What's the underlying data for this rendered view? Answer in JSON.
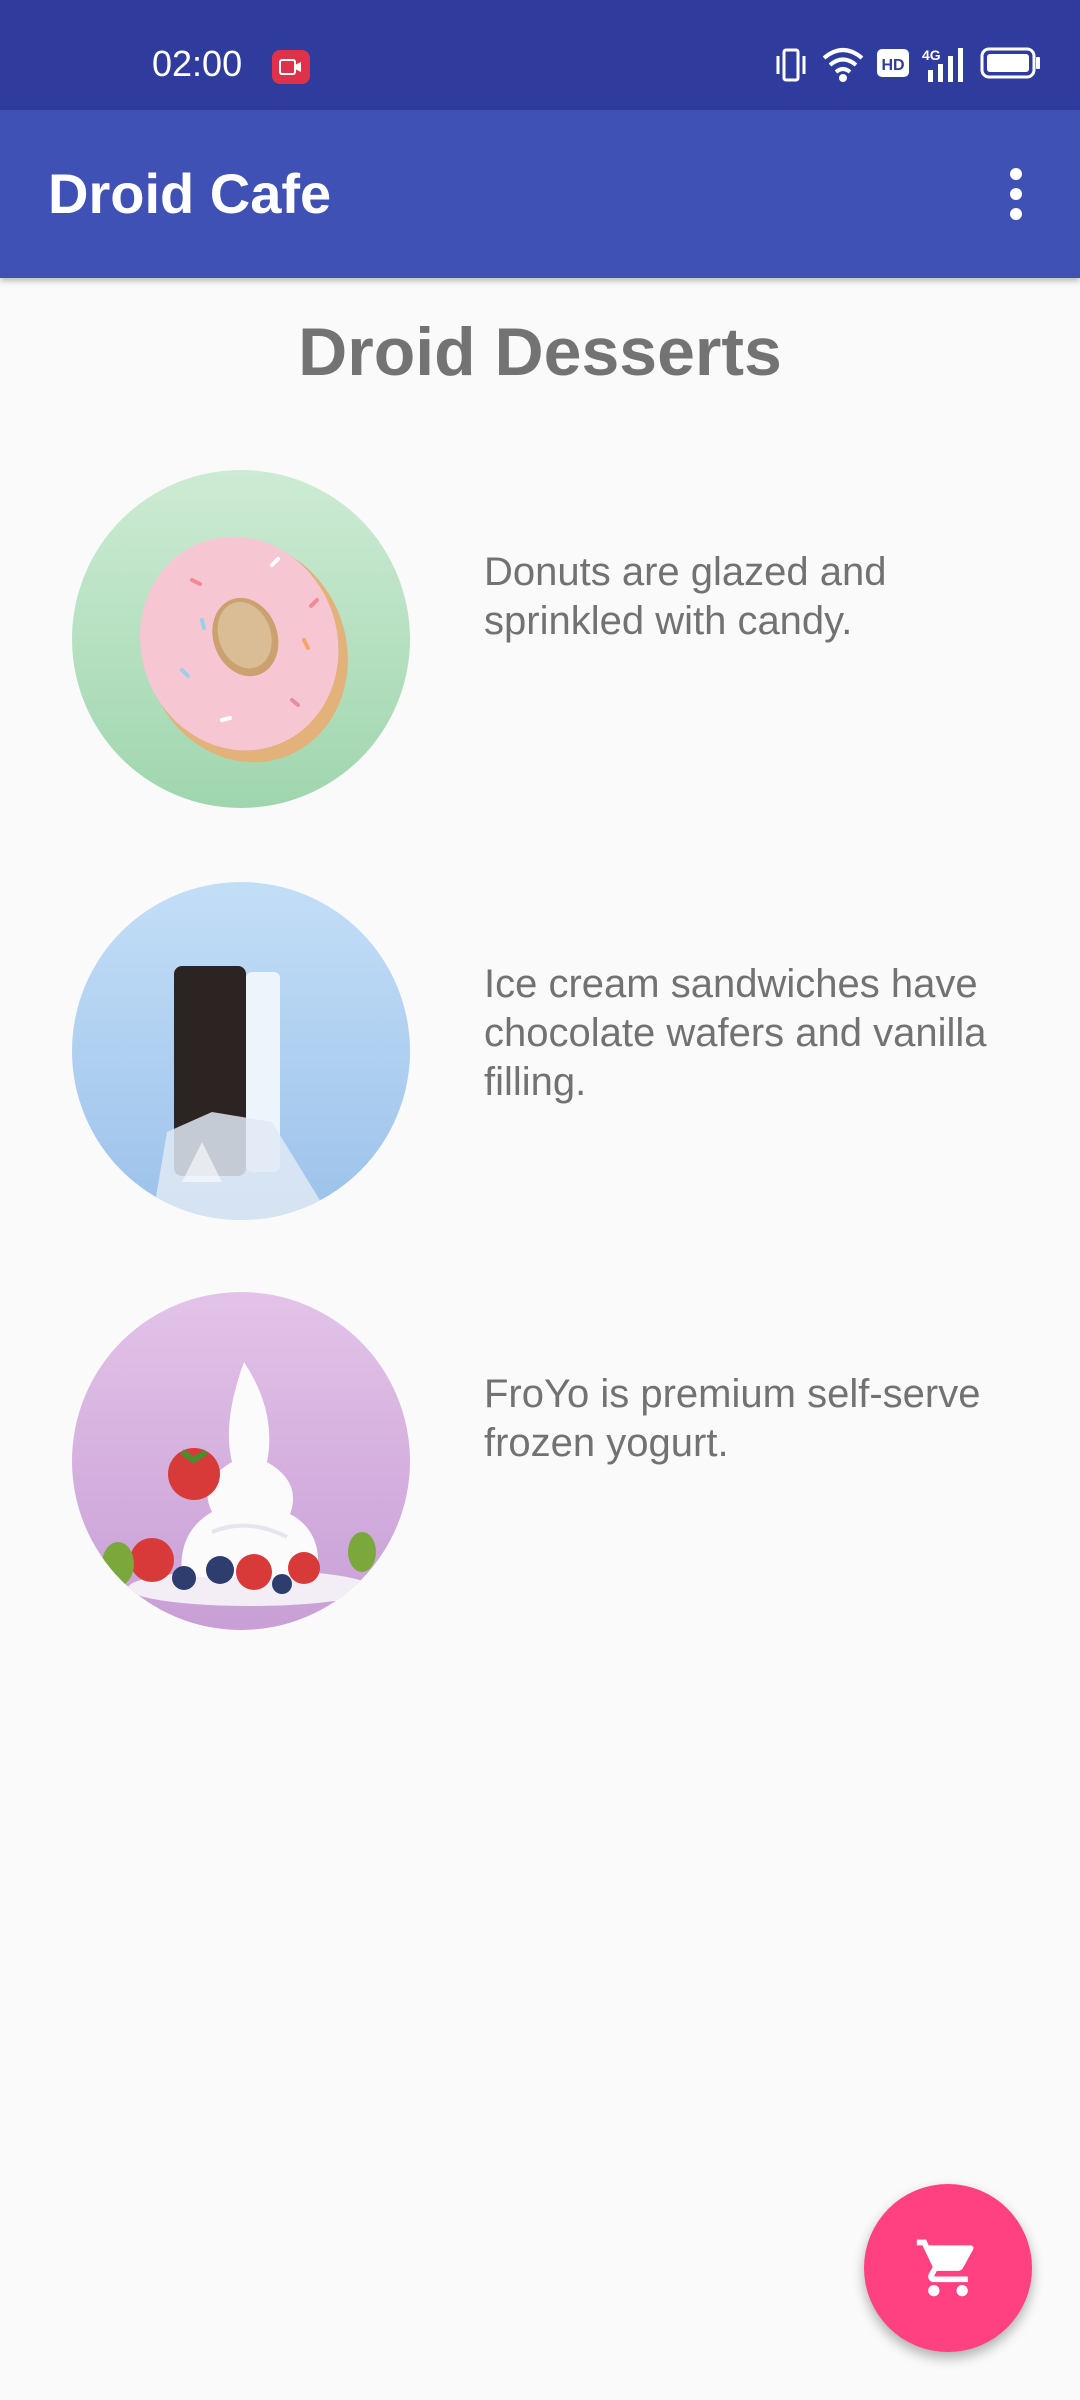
{
  "status_bar": {
    "time": "02:00",
    "icons": [
      "screen-record-icon",
      "vibrate-icon",
      "wifi-icon",
      "hd-icon",
      "signal-4g-icon",
      "battery-icon"
    ],
    "network": "4G",
    "hd": "HD"
  },
  "app_bar": {
    "title": "Droid Cafe",
    "menu_icon": "overflow-menu-icon"
  },
  "main": {
    "title": "Droid Desserts",
    "items": [
      {
        "name": "donut",
        "description": "Donuts are glazed and sprinkled with candy."
      },
      {
        "name": "ice-cream-sandwich",
        "description": "Ice cream sandwiches have chocolate wafers and vanilla filling."
      },
      {
        "name": "froyo",
        "description": "FroYo is premium self-serve frozen yogurt."
      }
    ]
  },
  "fab": {
    "icon": "cart-icon"
  },
  "colors": {
    "status_bar": "#2f3c9d",
    "app_bar": "#3f51b5",
    "fab": "#ff4081",
    "text": "#727272"
  }
}
